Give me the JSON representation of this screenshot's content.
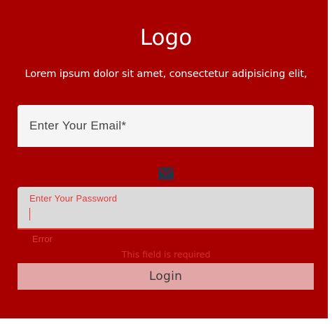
{
  "header": {
    "logo": "Logo",
    "tagline": "Lorem ipsum dolor sit amet, consectetur adipisicing elit,"
  },
  "email": {
    "placeholder": "Enter Your Email*",
    "value": "",
    "icon": "mail-icon"
  },
  "password": {
    "label": "Enter Your Password",
    "value": "",
    "error": "Error"
  },
  "form": {
    "required_message": "This field is required",
    "login_label": "Login"
  },
  "colors": {
    "background": "#a80000",
    "field_background": "#f5f5f5",
    "focused_field_background": "#dadada",
    "error": "#e53935",
    "button_background": "#e3a6a6",
    "icon": "#2d3142"
  }
}
